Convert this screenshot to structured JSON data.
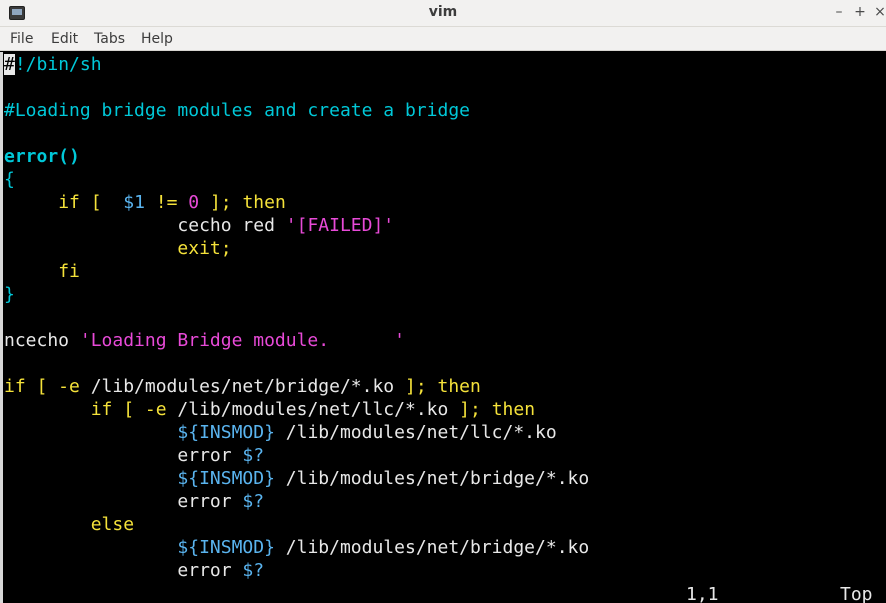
{
  "window": {
    "title": "vim",
    "minimize_glyph": "–",
    "maximize_glyph": "+",
    "close_glyph": "×"
  },
  "menu": {
    "file": "File",
    "edit": "Edit",
    "tabs": "Tabs",
    "help": "Help"
  },
  "editor": {
    "lines": [
      [
        {
          "t": "#",
          "c": "cursor"
        },
        {
          "t": "!/bin/sh",
          "c": "comment"
        }
      ],
      [],
      [
        {
          "t": "#Loading bridge modules and create a bridge",
          "c": "comment"
        }
      ],
      [],
      [
        {
          "t": "error()",
          "c": "func"
        }
      ],
      [
        {
          "t": "{",
          "c": "brace"
        }
      ],
      [
        {
          "t": "     ",
          "c": "plain"
        },
        {
          "t": "if",
          "c": "keyword"
        },
        {
          "t": " [  ",
          "c": "keyword"
        },
        {
          "t": "$1",
          "c": "var"
        },
        {
          "t": " != ",
          "c": "keyword"
        },
        {
          "t": "0",
          "c": "string"
        },
        {
          "t": " ]; then",
          "c": "keyword"
        }
      ],
      [
        {
          "t": "                cecho red ",
          "c": "plain"
        },
        {
          "t": "'[FAILED]'",
          "c": "string"
        }
      ],
      [
        {
          "t": "                ",
          "c": "plain"
        },
        {
          "t": "exit;",
          "c": "keyword"
        }
      ],
      [
        {
          "t": "     ",
          "c": "plain"
        },
        {
          "t": "fi",
          "c": "keyword"
        }
      ],
      [
        {
          "t": "}",
          "c": "brace"
        }
      ],
      [],
      [
        {
          "t": "ncecho ",
          "c": "plain"
        },
        {
          "t": "'Loading Bridge module.      '",
          "c": "string"
        }
      ],
      [],
      [
        {
          "t": "if [ -e ",
          "c": "keyword"
        },
        {
          "t": "/lib/modules/net/bridge/*.ko",
          "c": "plain"
        },
        {
          "t": " ]; then",
          "c": "keyword"
        }
      ],
      [
        {
          "t": "        ",
          "c": "plain"
        },
        {
          "t": "if [ -e ",
          "c": "keyword"
        },
        {
          "t": "/lib/modules/net/llc/*.ko",
          "c": "plain"
        },
        {
          "t": " ]; then",
          "c": "keyword"
        }
      ],
      [
        {
          "t": "                ",
          "c": "plain"
        },
        {
          "t": "${INSMOD}",
          "c": "var"
        },
        {
          "t": " /lib/modules/net/llc/*.ko",
          "c": "plain"
        }
      ],
      [
        {
          "t": "                error ",
          "c": "plain"
        },
        {
          "t": "$?",
          "c": "var"
        }
      ],
      [
        {
          "t": "                ",
          "c": "plain"
        },
        {
          "t": "${INSMOD}",
          "c": "var"
        },
        {
          "t": " /lib/modules/net/bridge/*.ko",
          "c": "plain"
        }
      ],
      [
        {
          "t": "                error ",
          "c": "plain"
        },
        {
          "t": "$?",
          "c": "var"
        }
      ],
      [
        {
          "t": "        ",
          "c": "plain"
        },
        {
          "t": "else",
          "c": "keyword"
        }
      ],
      [
        {
          "t": "                ",
          "c": "plain"
        },
        {
          "t": "${INSMOD}",
          "c": "var"
        },
        {
          "t": " /lib/modules/net/bridge/*.ko",
          "c": "plain"
        }
      ],
      [
        {
          "t": "                error ",
          "c": "plain"
        },
        {
          "t": "$?",
          "c": "var"
        }
      ]
    ]
  },
  "status": {
    "position": "1,1",
    "scroll": "Top"
  },
  "colors": {
    "comment": "#00c8d8",
    "keyword": "#f5e23a",
    "variable": "#5ab4ef",
    "string": "#e84ad8",
    "background": "#000000"
  }
}
